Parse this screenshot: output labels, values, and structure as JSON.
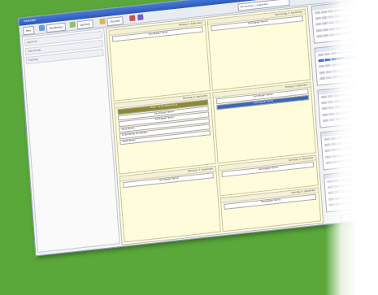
{
  "window": {
    "title": "Kalender"
  },
  "toolbar": {
    "buttons": [
      "Neu",
      "Bearbeiten",
      "Löschen",
      "Drucken"
    ],
    "date_range": "Donnerstag, 1. September"
  },
  "sidebar": {
    "rows": [
      "Allgemein",
      "Geburtstage",
      "Feiertage"
    ]
  },
  "days": [
    {
      "header": "Montag, 5. September",
      "events": [
        "Ganztägiger Termin"
      ]
    },
    {
      "header": "Donnerstag, 1. September",
      "events": [
        "Ganztägiger Termin"
      ]
    },
    {
      "header": "Dienstag, 6. September",
      "events": [
        "10:00 - 11:00 Besprechung",
        "Ganztägiger Termin",
        "Ganztägiger Termin",
        "12:00 Termin",
        "14:00 Termin mit Notizen",
        "16:00 Termin"
      ]
    },
    {
      "header": "Freitag, 2. September",
      "events": [
        "Ganztägiger Termin",
        "Ganztägiger Termin"
      ]
    },
    {
      "header": "Mittwoch, 7. September",
      "events": [
        "Ganztägiger Termin"
      ]
    },
    {
      "header": "Samstag, 3. September",
      "events": [
        "Ganztägiger Termin"
      ]
    },
    {
      "header": "Sonntag, 4. September",
      "events": [
        "Ganztägiger Termin"
      ]
    }
  ],
  "mini_calendars": [
    "August",
    "September",
    "Oktober",
    "November",
    "Dezember"
  ],
  "today_button": "Heute",
  "colors": {
    "background": "#5aa83a",
    "day_cell": "#fffcdb",
    "selection": "#3a66b8",
    "accent_event": "#8c8a2e"
  }
}
